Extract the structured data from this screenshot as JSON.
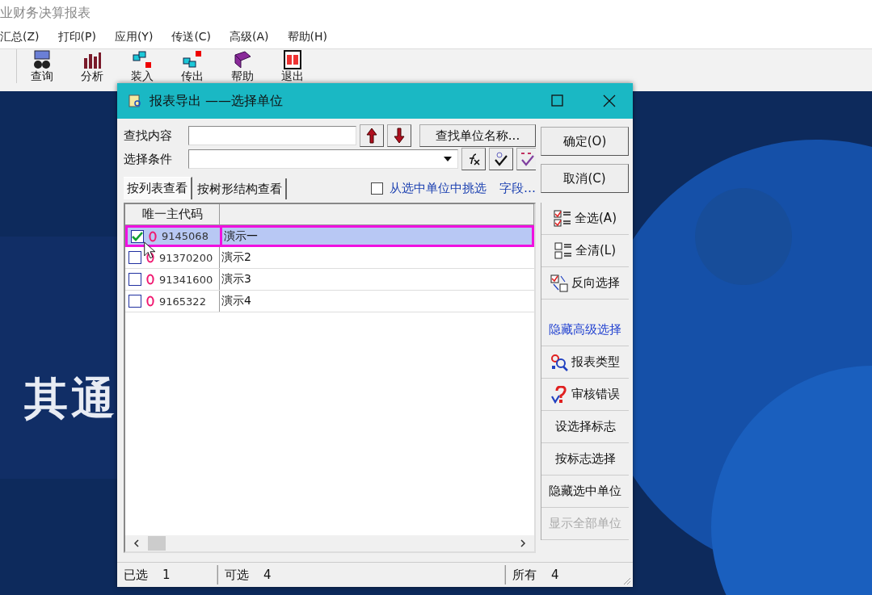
{
  "app": {
    "title": "业财务决算报表",
    "menu": [
      "汇总(Z)",
      "打印(P)",
      "应用(Y)",
      "传送(C)",
      "高级(A)",
      "帮助(H)"
    ],
    "toolbar": [
      {
        "label": "查询",
        "kind": "query"
      },
      {
        "label": "分析",
        "kind": "chart"
      },
      {
        "label": "装入",
        "kind": "import"
      },
      {
        "label": "传出",
        "kind": "export"
      },
      {
        "label": "帮助",
        "kind": "help"
      },
      {
        "label": "退出",
        "kind": "exit"
      }
    ],
    "background_text": "其通"
  },
  "dialog": {
    "title": "报表导出 ——选择单位",
    "find_label": "查找内容",
    "find_button": "查找单位名称...",
    "condition_label": "选择条件",
    "ok_button": "确定(O)",
    "cancel_button": "取消(C)",
    "tabs": [
      {
        "label": "按列表查看",
        "selected": true
      },
      {
        "label": "按树形结构查看",
        "selected": false
      }
    ],
    "filter_checkbox": {
      "label": "从选中单位中挑选",
      "checked": false
    },
    "fields_link": "字段…",
    "list": {
      "columns": [
        "唯一主代码"
      ],
      "rows": [
        {
          "code": "9145068",
          "name": "演示一",
          "checked": true,
          "selected": true
        },
        {
          "code": "91370200",
          "name": "演示2",
          "checked": false,
          "selected": false
        },
        {
          "code": "91341600",
          "name": "演示3",
          "checked": false,
          "selected": false
        },
        {
          "code": "9165322",
          "name": "演示4",
          "checked": false,
          "selected": false
        }
      ]
    },
    "side_buttons": [
      {
        "label": "全选(A)",
        "kind": "selectall",
        "disabled": false
      },
      {
        "label": "全清(L)",
        "kind": "clearall",
        "disabled": false
      },
      {
        "label": "反向选择",
        "kind": "invert",
        "disabled": false
      },
      {
        "label": "隐藏高级选择",
        "kind": "toggle",
        "disabled": false
      },
      {
        "label": "报表类型",
        "kind": "reporttype",
        "disabled": false
      },
      {
        "label": "审核错误",
        "kind": "audit",
        "disabled": false
      },
      {
        "label": "设选择标志",
        "kind": "plain",
        "disabled": false
      },
      {
        "label": "按标志选择",
        "kind": "plain",
        "disabled": false
      },
      {
        "label": "隐藏选中单位",
        "kind": "plain",
        "disabled": false
      },
      {
        "label": "显示全部单位",
        "kind": "plain",
        "disabled": true
      }
    ],
    "status_bar": [
      {
        "label": "已选",
        "value": "1"
      },
      {
        "label": "可选",
        "value": "4"
      },
      {
        "label": "所有",
        "value": "4"
      }
    ]
  }
}
